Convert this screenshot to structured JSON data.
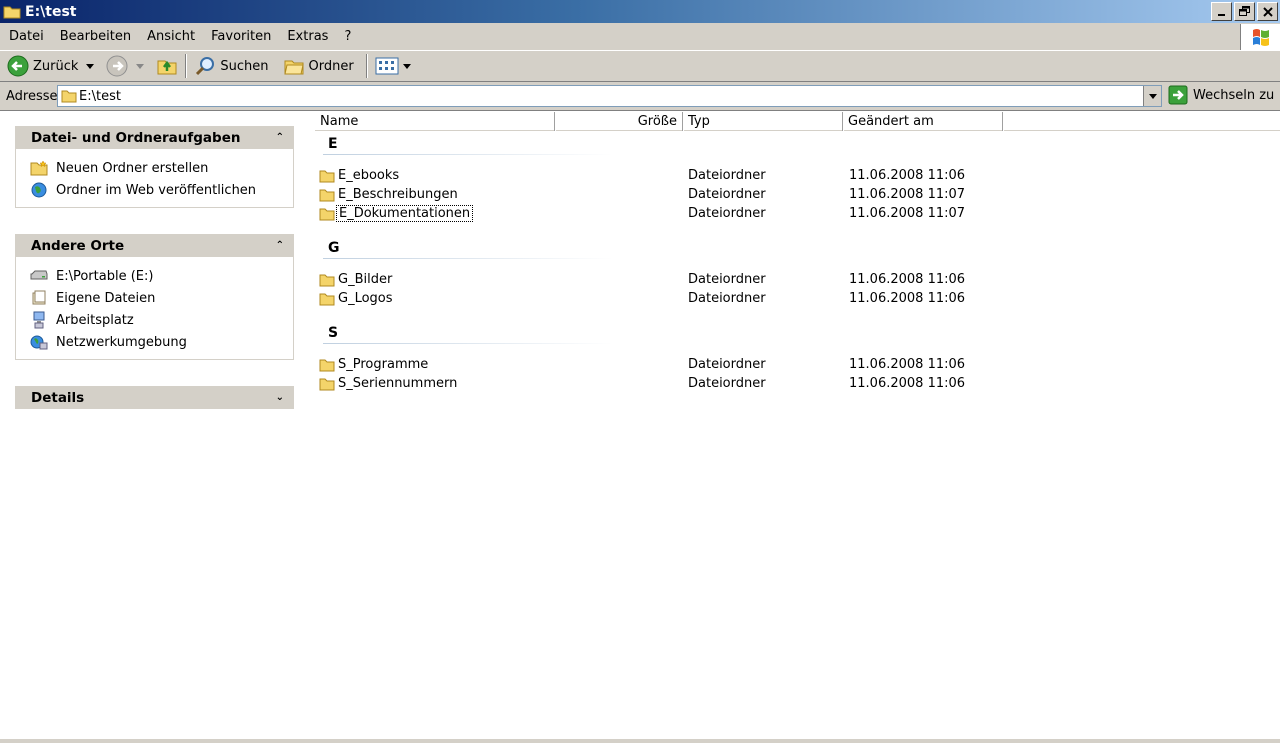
{
  "window": {
    "title": "E:\\test"
  },
  "menu": [
    "Datei",
    "Bearbeiten",
    "Ansicht",
    "Favoriten",
    "Extras",
    "?"
  ],
  "toolbar": {
    "back": "Zurück",
    "search": "Suchen",
    "folders": "Ordner"
  },
  "address": {
    "label": "Adresse",
    "value": "E:\\test",
    "go": "Wechseln zu"
  },
  "tasks": {
    "title": "Datei- und Ordneraufgaben",
    "items": [
      "Neuen Ordner erstellen",
      "Ordner im Web veröffentlichen"
    ]
  },
  "places": {
    "title": "Andere Orte",
    "items": [
      "E:\\Portable (E:)",
      "Eigene Dateien",
      "Arbeitsplatz",
      "Netzwerkumgebung"
    ]
  },
  "details": {
    "title": "Details"
  },
  "columns": {
    "name": "Name",
    "size": "Größe",
    "type": "Typ",
    "modified": "Geändert am"
  },
  "groups": [
    {
      "letter": "E",
      "files": [
        {
          "name": "E_ebooks",
          "type": "Dateiordner",
          "modified": "11.06.2008 11:06"
        },
        {
          "name": "E_Beschreibungen",
          "type": "Dateiordner",
          "modified": "11.06.2008 11:07"
        },
        {
          "name": "E_Dokumentationen",
          "type": "Dateiordner",
          "modified": "11.06.2008 11:07"
        }
      ]
    },
    {
      "letter": "G",
      "files": [
        {
          "name": "G_Bilder",
          "type": "Dateiordner",
          "modified": "11.06.2008 11:06"
        },
        {
          "name": "G_Logos",
          "type": "Dateiordner",
          "modified": "11.06.2008 11:06"
        }
      ]
    },
    {
      "letter": "S",
      "files": [
        {
          "name": "S_Programme",
          "type": "Dateiordner",
          "modified": "11.06.2008 11:06"
        },
        {
          "name": "S_Seriennummern",
          "type": "Dateiordner",
          "modified": "11.06.2008 11:06"
        }
      ]
    }
  ]
}
